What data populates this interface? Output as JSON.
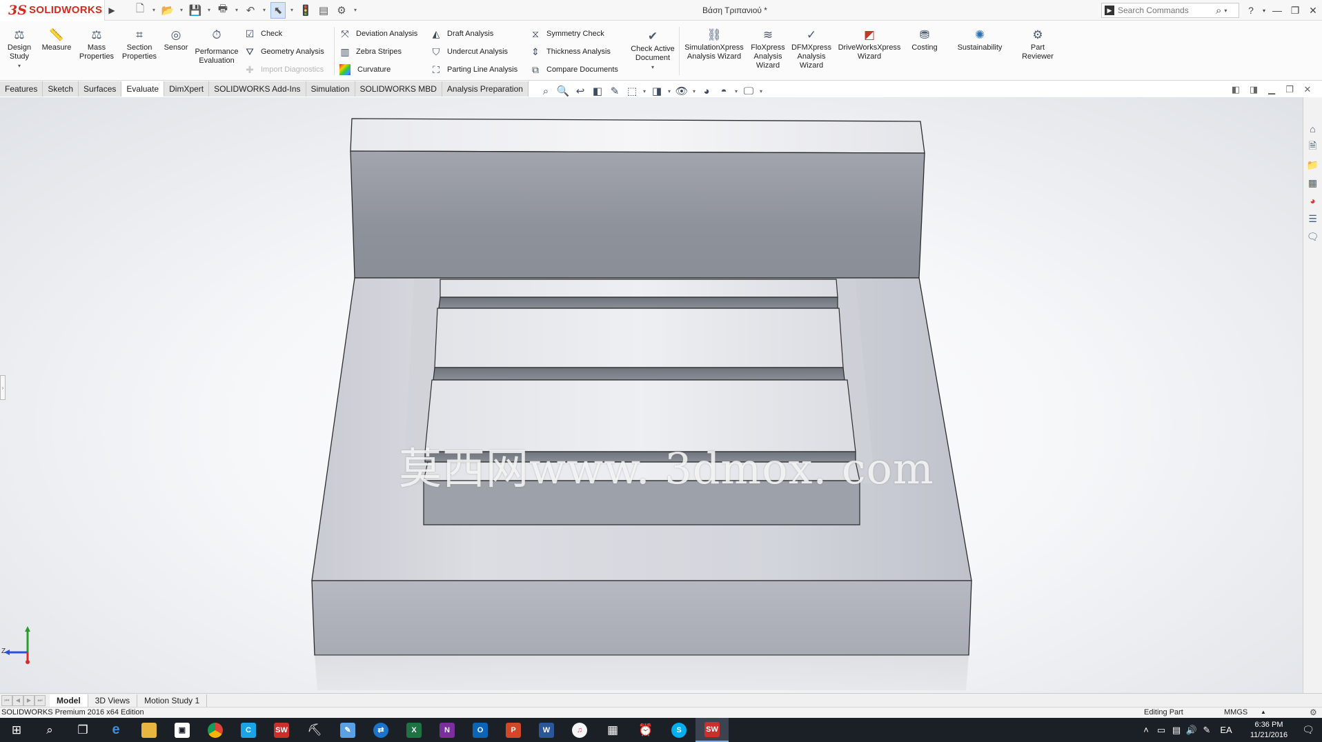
{
  "app": {
    "logo_ds": "3S",
    "logo_text": "SOLIDWORKS",
    "document_title": "Βάση Τριπανιού *",
    "search_placeholder": "Search Commands",
    "help_label": "?"
  },
  "ribbon": {
    "large_buttons": [
      {
        "id": "design-study",
        "label": "Design Study",
        "icon": "design-study-icon"
      },
      {
        "id": "measure",
        "label": "Measure",
        "icon": "measure-icon"
      },
      {
        "id": "mass-properties",
        "label": "Mass Properties",
        "icon": "mass-properties-icon"
      },
      {
        "id": "section-properties",
        "label": "Section Properties",
        "icon": "section-properties-icon"
      },
      {
        "id": "sensor",
        "label": "Sensor",
        "icon": "sensor-icon"
      },
      {
        "id": "performance-evaluation",
        "label": "Performance Evaluation",
        "icon": "performance-evaluation-icon"
      },
      {
        "id": "check-active-document",
        "label": "Check Active Document",
        "icon": "check-active-document-icon"
      },
      {
        "id": "simulationxpress",
        "label": "SimulationXpress Analysis Wizard",
        "icon": "simulationxpress-icon"
      },
      {
        "id": "floxpress",
        "label": "FloXpress Analysis Wizard",
        "icon": "floxpress-icon"
      },
      {
        "id": "dfmxpress",
        "label": "DFMXpress Analysis Wizard",
        "icon": "dfmxpress-icon"
      },
      {
        "id": "driveworksxpress",
        "label": "DriveWorksXpress Wizard",
        "icon": "driveworksxpress-icon"
      },
      {
        "id": "costing",
        "label": "Costing",
        "icon": "costing-icon"
      },
      {
        "id": "sustainability",
        "label": "Sustainability",
        "icon": "sustainability-icon"
      },
      {
        "id": "part-reviewer",
        "label": "Part Reviewer",
        "icon": "part-reviewer-icon"
      }
    ],
    "small_buttons": [
      {
        "id": "check",
        "label": "Check",
        "enabled": true
      },
      {
        "id": "geometry-analysis",
        "label": "Geometry Analysis",
        "enabled": true
      },
      {
        "id": "import-diagnostics",
        "label": "Import Diagnostics",
        "enabled": false
      },
      {
        "id": "deviation-analysis",
        "label": "Deviation Analysis",
        "enabled": true
      },
      {
        "id": "zebra-stripes",
        "label": "Zebra Stripes",
        "enabled": true
      },
      {
        "id": "curvature",
        "label": "Curvature",
        "enabled": true
      },
      {
        "id": "draft-analysis",
        "label": "Draft Analysis",
        "enabled": true
      },
      {
        "id": "undercut-analysis",
        "label": "Undercut Analysis",
        "enabled": true
      },
      {
        "id": "parting-line-analysis",
        "label": "Parting Line Analysis",
        "enabled": true
      },
      {
        "id": "symmetry-check",
        "label": "Symmetry Check",
        "enabled": true
      },
      {
        "id": "thickness-analysis",
        "label": "Thickness Analysis",
        "enabled": true
      },
      {
        "id": "compare-documents",
        "label": "Compare Documents",
        "enabled": true
      }
    ]
  },
  "command_tabs": [
    "Features",
    "Sketch",
    "Surfaces",
    "Evaluate",
    "DimXpert",
    "SOLIDWORKS Add-Ins",
    "Simulation",
    "SOLIDWORKS MBD",
    "Analysis Preparation"
  ],
  "active_command_tab": "Evaluate",
  "viewport": {
    "watermark": "莫西网www. 3dmox. com",
    "triad_z_label": "Z"
  },
  "bottom_tabs": [
    "Model",
    "3D Views",
    "Motion Study 1"
  ],
  "active_bottom_tab": "Model",
  "status": {
    "edition": "SOLIDWORKS Premium 2016 x64 Edition",
    "mode": "Editing Part",
    "units": "MMGS"
  },
  "taskbar": {
    "language": "EA",
    "time": "6:36 PM",
    "date": "11/21/2016",
    "apps": [
      "start-icon",
      "search-icon",
      "task-view-icon",
      "edge-icon",
      "file-explorer-icon",
      "store-icon",
      "chrome-icon",
      "ccleaner-icon",
      "solidworks-icon",
      "hardware-icon",
      "skype-for-business-icon",
      "teamviewer-icon",
      "excel-icon",
      "onenote-icon",
      "outlook-icon",
      "powerpoint-icon",
      "word-icon",
      "itunes-icon",
      "calculator-icon",
      "alarms-icon",
      "skype-icon",
      "solidworks-2016-icon"
    ]
  },
  "colors": {
    "brand_red": "#d52b1e",
    "taskbar_bg": "#1b1f26"
  }
}
